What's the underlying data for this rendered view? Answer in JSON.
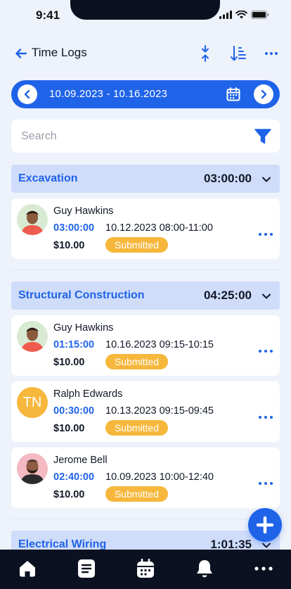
{
  "status_bar": {
    "time": "9:41"
  },
  "header": {
    "title": "Time Logs"
  },
  "date_range": "10.09.2023 - 10.16.2023",
  "search": {
    "placeholder": "Search",
    "value": ""
  },
  "groups": [
    {
      "name": "Excavation",
      "total": "03:00:00",
      "logs": [
        {
          "user": "Guy Hawkins",
          "duration": "03:00:00",
          "date_time": "10.12.2023 08:00-11:00",
          "amount": "$10.00",
          "status": "Submitted"
        }
      ]
    },
    {
      "name": "Structural Construction",
      "total": "04:25:00",
      "logs": [
        {
          "user": "Guy Hawkins",
          "duration": "01:15:00",
          "date_time": "10.16.2023 09:15-10:15",
          "amount": "$10.00",
          "status": "Submitted"
        },
        {
          "user": "Ralph Edwards",
          "initials": "TN",
          "duration": "00:30:00",
          "date_time": "10.13.2023 09:15-09:45",
          "amount": "$10.00",
          "status": "Submitted"
        },
        {
          "user": "Jerome Bell",
          "duration": "02:40:00",
          "date_time": "10.09.2023 10:00-12:40",
          "amount": "$10.00",
          "status": "Submitted"
        }
      ]
    },
    {
      "name": "Electrical Wiring",
      "total": "1:01:35",
      "logs": []
    }
  ],
  "colors": {
    "accent": "#1f63e8",
    "badge": "#f6b73c",
    "nav_bg": "#0b1120",
    "group_bg": "#cfdcfa"
  }
}
